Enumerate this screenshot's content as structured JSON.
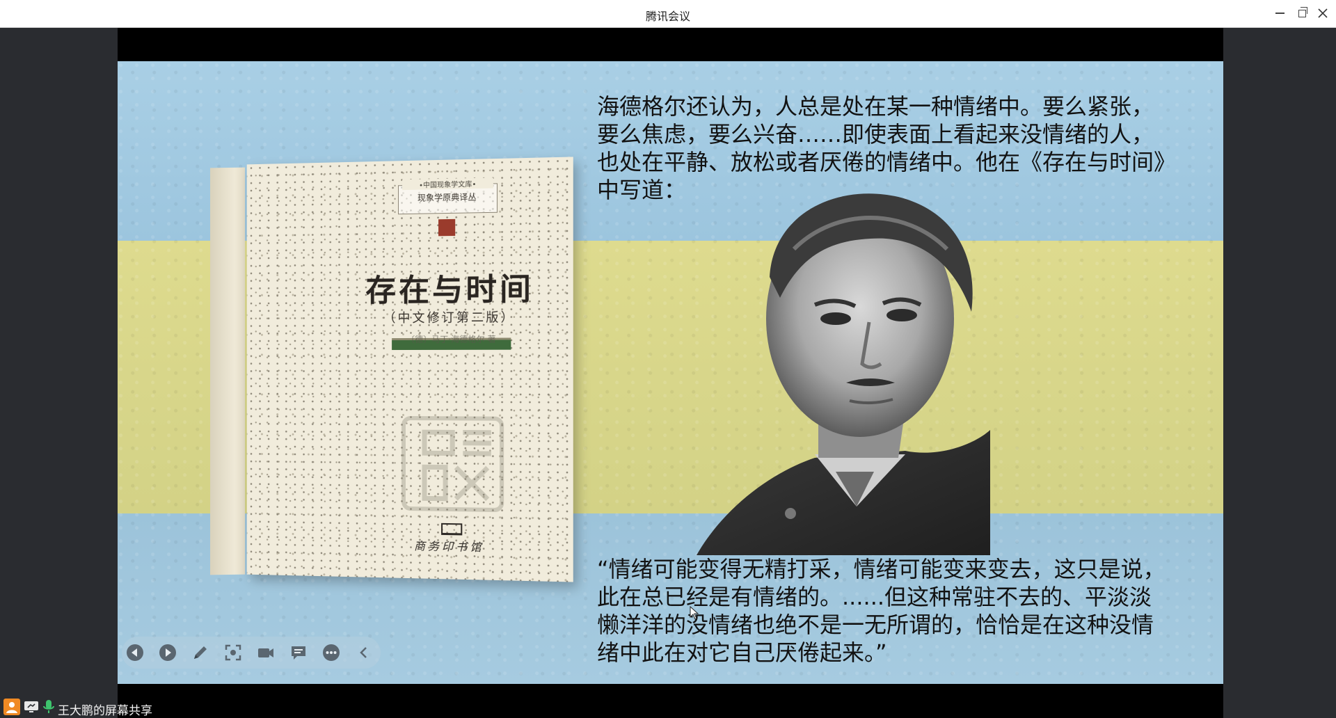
{
  "window": {
    "title": "腾讯会议"
  },
  "slide": {
    "intro_lines": [
      "海德格尔还认为，人总是处在某一种情绪中。要么紧张，",
      "要么焦虑，要么兴奋……即使表面上看起来没情绪的人，",
      "也处在平静、放松或者厌倦的情绪中。他在《存在与时间》",
      "中写道："
    ],
    "quote_lines": [
      "“情绪可能变得无精打采，情绪可能变来变去，这只是说，",
      "此在总已经是有情绪的。......但这种常驻不去的、平淡淡",
      "懒洋洋的没情绪也绝不是一无所谓的，恰恰是在这种没情",
      "绪中此在对它自己厌倦起来。”"
    ],
    "book": {
      "series_top": "•中国现象学文库•",
      "series": "现象学原典译丛",
      "title": "存在与时间",
      "subtitle": "（中文修订第二版）",
      "author": "〔德〕马丁·海德格尔 著",
      "publisher": "商务印书馆"
    },
    "colors": {
      "sky": "#a3c9e0",
      "band": "#dcd98c"
    }
  },
  "toolbar": {
    "buttons": [
      "prev-icon",
      "play-icon",
      "pen-icon",
      "screenshot-icon",
      "camera-icon",
      "comment-icon",
      "more-icon",
      "collapse-icon"
    ]
  },
  "status": {
    "share_label": "王大鹏的屏幕共享"
  }
}
